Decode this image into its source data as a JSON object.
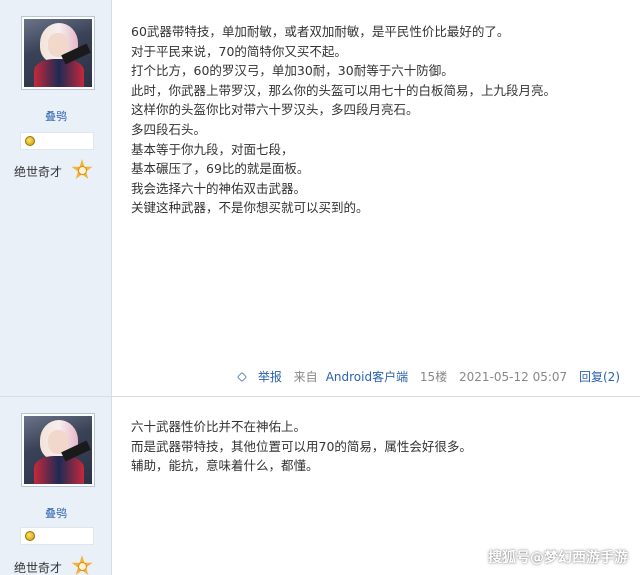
{
  "posts": [
    {
      "username": "叠鸮",
      "rank": "绝世奇才",
      "lines": [
        "60武器带特技，单加耐敏，或者双加耐敏，是平民性价比最好的了。",
        "对于平民来说，70的简特你又买不起。",
        "打个比方，60的罗汉弓，单加30耐，30耐等于六十防御。",
        "此时，你武器上带罗汉，那么你的头盔可以用七十的白板简易，上九段月亮。",
        "这样你的头盔你比对带六十罗汉头，多四段月亮石。",
        "多四段石头。",
        "基本等于你九段，对面七段，",
        "基本碾压了，69比的就是面板。",
        "我会选择六十的神佑双击武器。",
        "关键这种武器，不是你想买就可以买到的。"
      ],
      "footer": {
        "report": "举报",
        "source": "来自",
        "client": "Android客户端",
        "floor": "15楼",
        "datetime": "2021-05-12 05:07",
        "reply": "回复(2)"
      }
    },
    {
      "username": "叠鸮",
      "rank": "绝世奇才",
      "lines": [
        "六十武器性价比并不在神佑上。",
        "而是武器带特技，其他位置可以用70的简易，属性会好很多。",
        "辅助，能抗，意味着什么，都懂。"
      ]
    }
  ],
  "watermark": "搜狐号@梦幻西游手游"
}
